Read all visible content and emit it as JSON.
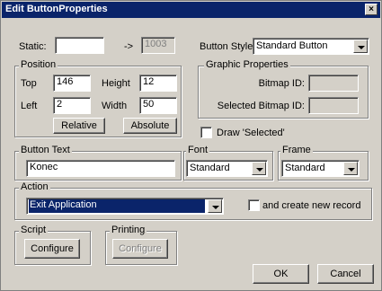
{
  "window": {
    "title": "Edit ButtonProperties",
    "close_glyph": "×"
  },
  "static": {
    "label": "Static:",
    "value": "",
    "arrow": "->",
    "id_value": "1003"
  },
  "button_style": {
    "label": "Button Style:",
    "value": "Standard Button"
  },
  "position": {
    "group_label": "Position",
    "top_label": "Top",
    "top_value": "146",
    "height_label": "Height",
    "height_value": "12",
    "left_label": "Left",
    "left_value": "2",
    "width_label": "Width",
    "width_value": "50",
    "relative_label": "Relative",
    "absolute_label": "Absolute"
  },
  "graphic": {
    "group_label": "Graphic Properties",
    "bitmap_id_label": "Bitmap ID:",
    "bitmap_id_value": "",
    "selected_bitmap_id_label": "Selected Bitmap ID:",
    "selected_bitmap_id_value": ""
  },
  "draw_selected": {
    "label": "Draw 'Selected'",
    "checked": false
  },
  "button_text": {
    "group_label": "Button Text",
    "value": "Konec"
  },
  "font": {
    "group_label": "Font",
    "value": "Standard"
  },
  "frame": {
    "group_label": "Frame",
    "value": "Standard"
  },
  "action": {
    "group_label": "Action",
    "value": "Exit Application",
    "create_record_label": "and create new record",
    "create_record_checked": false
  },
  "script": {
    "group_label": "Script",
    "configure_label": "Configure"
  },
  "printing": {
    "group_label": "Printing",
    "configure_label": "Configure"
  },
  "footer": {
    "ok_label": "OK",
    "cancel_label": "Cancel"
  }
}
